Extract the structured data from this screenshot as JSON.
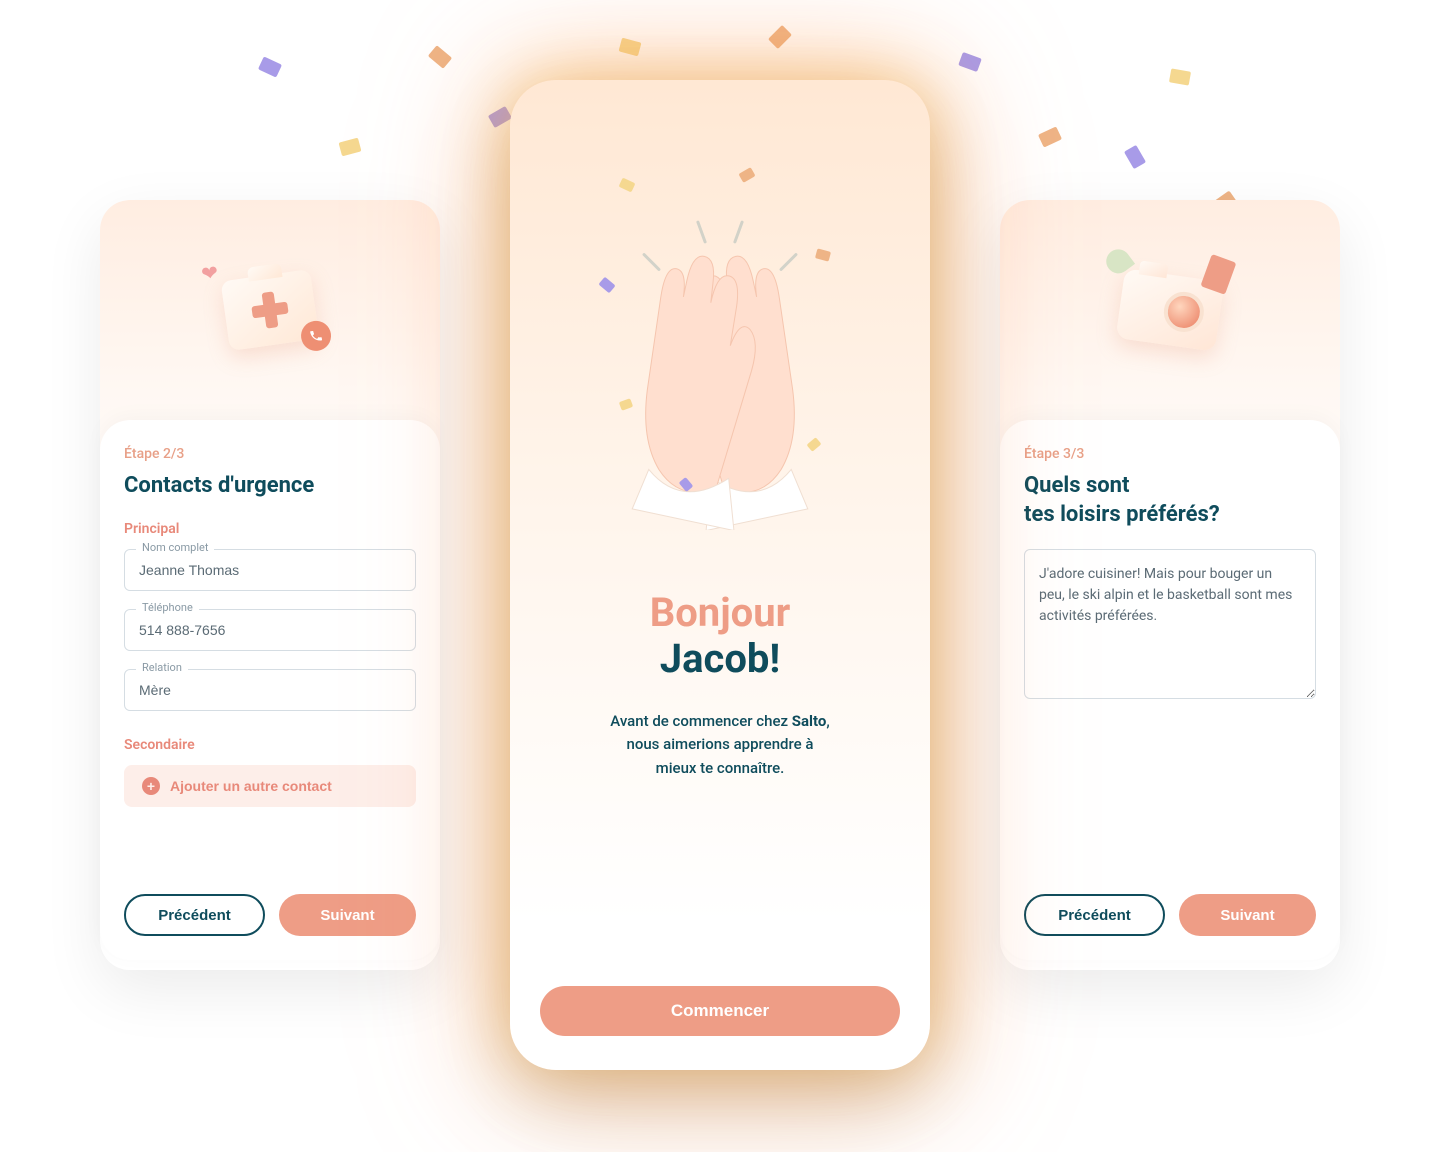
{
  "colors": {
    "accent": "#EE9D86",
    "dark": "#0F4C5C",
    "soft_bg": "#FDEEE9"
  },
  "left_card": {
    "step": "Étape 2/3",
    "title": "Contacts d'urgence",
    "primary_label": "Principal",
    "name_label": "Nom complet",
    "name_value": "Jeanne Thomas",
    "phone_label": "Téléphone",
    "phone_value": "514 888-7656",
    "relation_label": "Relation",
    "relation_value": "Mère",
    "secondary_label": "Secondaire",
    "add_contact_label": "Ajouter un autre contact",
    "prev_label": "Précédent",
    "next_label": "Suivant"
  },
  "center": {
    "greeting_line1": "Bonjour",
    "greeting_line2": "Jacob!",
    "sub_prefix": "Avant de commencer chez ",
    "brand": "Salto",
    "sub_line2": "nous aimerions apprendre à",
    "sub_line3": "mieux te connaître.",
    "start_label": "Commencer"
  },
  "right_card": {
    "step": "Étape 3/3",
    "title_line1": "Quels sont",
    "title_line2": "tes loisirs préférés?",
    "textarea_value": "J'adore cuisiner! Mais pour bouger un peu, le ski alpin et le basketball sont mes activités préférées.",
    "prev_label": "Précédent",
    "next_label": "Suivant"
  }
}
